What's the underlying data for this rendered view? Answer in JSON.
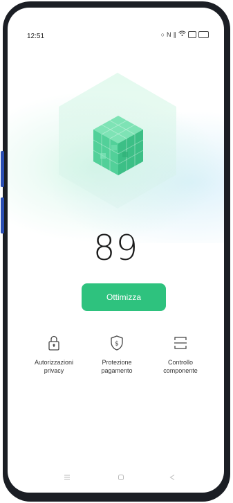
{
  "status_bar": {
    "time": "12:51",
    "icons": [
      "alarm-icon",
      "nfc-icon",
      "vibrate-icon",
      "wifi-icon",
      "sim-icon",
      "battery-icon"
    ]
  },
  "score": {
    "value": "89"
  },
  "optimize": {
    "label": "Ottimizza"
  },
  "features": [
    {
      "icon": "lock-icon",
      "line1": "Autorizzazioni",
      "line2": "privacy"
    },
    {
      "icon": "shield-dollar-icon",
      "line1": "Protezione",
      "line2": "pagamento"
    },
    {
      "icon": "component-icon",
      "line1": "Controllo",
      "line2": "componente"
    }
  ],
  "nav_bar": {
    "buttons": [
      "menu-icon",
      "home-icon",
      "back-icon"
    ]
  },
  "colors": {
    "accent": "#2ec27e",
    "cube": "#4fd39a",
    "frame": "#1b1e24",
    "side_buttons": "#2b4fb3"
  }
}
